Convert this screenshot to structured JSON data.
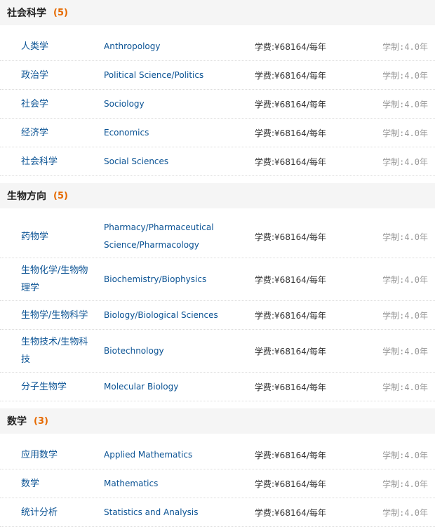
{
  "fee_label": "学费:",
  "duration_label": "学制:",
  "sections": [
    {
      "title": "社会科学",
      "count": "(5)",
      "rows": [
        {
          "cn": "人类学",
          "en": "Anthropology",
          "fee": "¥68164/每年",
          "duration": "4.0年"
        },
        {
          "cn": "政治学",
          "en": "Political Science/Politics",
          "fee": "¥68164/每年",
          "duration": "4.0年"
        },
        {
          "cn": "社会学",
          "en": "Sociology",
          "fee": "¥68164/每年",
          "duration": "4.0年"
        },
        {
          "cn": "经济学",
          "en": "Economics",
          "fee": "¥68164/每年",
          "duration": "4.0年"
        },
        {
          "cn": "社会科学",
          "en": "Social Sciences",
          "fee": "¥68164/每年",
          "duration": "4.0年"
        }
      ]
    },
    {
      "title": "生物方向",
      "count": "(5)",
      "rows": [
        {
          "cn": "药物学",
          "en": "Pharmacy/Pharmaceutical Science/Pharmacology",
          "fee": "¥68164/每年",
          "duration": "4.0年"
        },
        {
          "cn": "生物化学/生物物理学",
          "en": "Biochemistry/Biophysics",
          "fee": "¥68164/每年",
          "duration": "4.0年"
        },
        {
          "cn": "生物学/生物科学",
          "en": "Biology/Biological Sciences",
          "fee": "¥68164/每年",
          "duration": "4.0年"
        },
        {
          "cn": "生物技术/生物科技",
          "en": "Biotechnology",
          "fee": "¥68164/每年",
          "duration": "4.0年"
        },
        {
          "cn": "分子生物学",
          "en": "Molecular Biology",
          "fee": "¥68164/每年",
          "duration": "4.0年"
        }
      ]
    },
    {
      "title": "数学",
      "count": "(3)",
      "rows": [
        {
          "cn": "应用数学",
          "en": "Applied Mathematics",
          "fee": "¥68164/每年",
          "duration": "4.0年"
        },
        {
          "cn": "数学",
          "en": "Mathematics",
          "fee": "¥68164/每年",
          "duration": "4.0年"
        },
        {
          "cn": "统计分析",
          "en": "Statistics and Analysis",
          "fee": "¥68164/每年",
          "duration": "4.0年"
        }
      ]
    }
  ]
}
